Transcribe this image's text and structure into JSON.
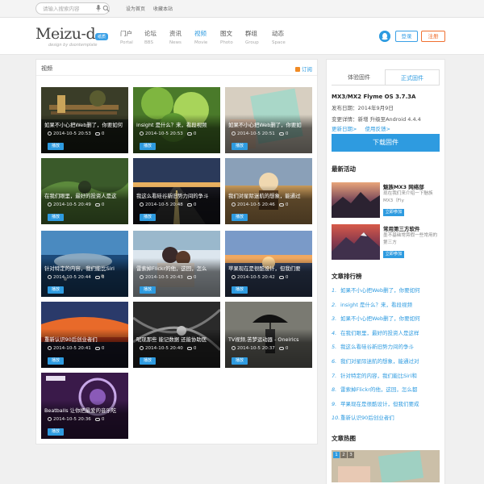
{
  "topbar": {
    "search_placeholder": "请输入搜索内容",
    "links": [
      "设为首页",
      "收藏本站"
    ]
  },
  "header": {
    "logo_text": "Meizu-d",
    "logo_badge": "纸质",
    "logo_tagline": "design by dsontemplate",
    "nav": [
      {
        "cn": "门户",
        "en": "Portal"
      },
      {
        "cn": "论坛",
        "en": "BBS"
      },
      {
        "cn": "资讯",
        "en": "News"
      },
      {
        "cn": "视频",
        "en": "Movie",
        "active": true
      },
      {
        "cn": "图文",
        "en": "Photo"
      },
      {
        "cn": "群组",
        "en": "Group"
      },
      {
        "cn": "动态",
        "en": "Space"
      }
    ],
    "login_label": "登录",
    "register_label": "注册"
  },
  "main": {
    "title": "视频",
    "rss_label": "订阅",
    "play_label": "播放",
    "cards": [
      {
        "title": "如果不小心把Web删了，你要如何",
        "date": "2014-10-5 20:53",
        "comments": "0",
        "img": "bench"
      },
      {
        "title": "insight 是什么？来，看段视频",
        "date": "2014-10-5 20:53",
        "comments": "0",
        "img": "leaves"
      },
      {
        "title": "如果不小心把Web删了，你要如",
        "date": "2014-10-5 20:51",
        "comments": "0",
        "img": "tablet"
      },
      {
        "title": "在我们眼里，最好的投资人是这",
        "date": "2014-10-5 20:49",
        "comments": "0",
        "img": "grass"
      },
      {
        "title": "我这么看硅谷新旧势力间的争斗",
        "date": "2014-10-5 20:48",
        "comments": "0",
        "img": "road"
      },
      {
        "title": "我们对星际迷航的想象，能通过",
        "date": "2014-10-5 20:46",
        "comments": "0",
        "img": "camel"
      },
      {
        "title": "针对特定的内容，我们能比Siri",
        "date": "2014-10-5 20:44",
        "comments": "0",
        "img": "shark"
      },
      {
        "title": "雷索掉Flickr的他，这回，怎么",
        "date": "2014-10-5 20:43",
        "comments": "0",
        "img": "couple"
      },
      {
        "title": "苹果现在是很酷设计，但我们要",
        "date": "2014-10-5 20:42",
        "comments": "0",
        "img": "sunset"
      },
      {
        "title": "重新认识90后创业者们",
        "date": "2014-10-5 20:41",
        "comments": "0",
        "img": "redsky"
      },
      {
        "title": "呢现那些 能记数据 还能协助医",
        "date": "2014-10-5 20:40",
        "comments": "0",
        "img": "cables"
      },
      {
        "title": "TV视频,苦梦运动器 - Oneirics",
        "date": "2014-10-5 20:37",
        "comments": "0",
        "img": "umbrella"
      },
      {
        "title": "Beatballs 让你把最爱的音乐吃",
        "date": "2014-10-5 20:36",
        "comments": "0",
        "img": "purple"
      }
    ]
  },
  "sidebar": {
    "tabs": [
      "体验固件",
      "正式固件"
    ],
    "firmware": {
      "title": "MX3/MX2 Flyme OS 3.7.3A",
      "date": "发布日期：2014年9月9日",
      "changelog": "变更详情：新增 升级至Android 4.4.4",
      "links": [
        "更新日期>",
        "使用反馈>"
      ],
      "download_label": "下载固件"
    },
    "activities_title": "最新活动",
    "activities": [
      {
        "name": "魅族MX3 网络部",
        "desc": "现在我们来介绍一下魅族MX3（Fly",
        "join": "立即参加"
      },
      {
        "name": "常用第三方软件",
        "desc": "墨不基础常旁假一些常用的第三方",
        "join": "立即参加"
      }
    ],
    "rank_title": "文章排行榜",
    "rank": [
      "如果不小心把Web删了，你要如何",
      "insight 是什么？来，看段视频",
      "如果不小心把Web删了，你要如何",
      "在我们眼里，最好的投资人是这样",
      "我这么看硅谷新旧势力间的争斗",
      "我们对星际迷航的想象，能通过对",
      "针对特定的内容，我们能比Siri和",
      "雷索掉Flickr的他，这回，怎么都",
      "苹果现在是很酷设计，但我们要成",
      "重新认识90后创业者们"
    ],
    "hot_title": "文章热图",
    "hot_pages": [
      "1",
      "2",
      "3"
    ]
  }
}
